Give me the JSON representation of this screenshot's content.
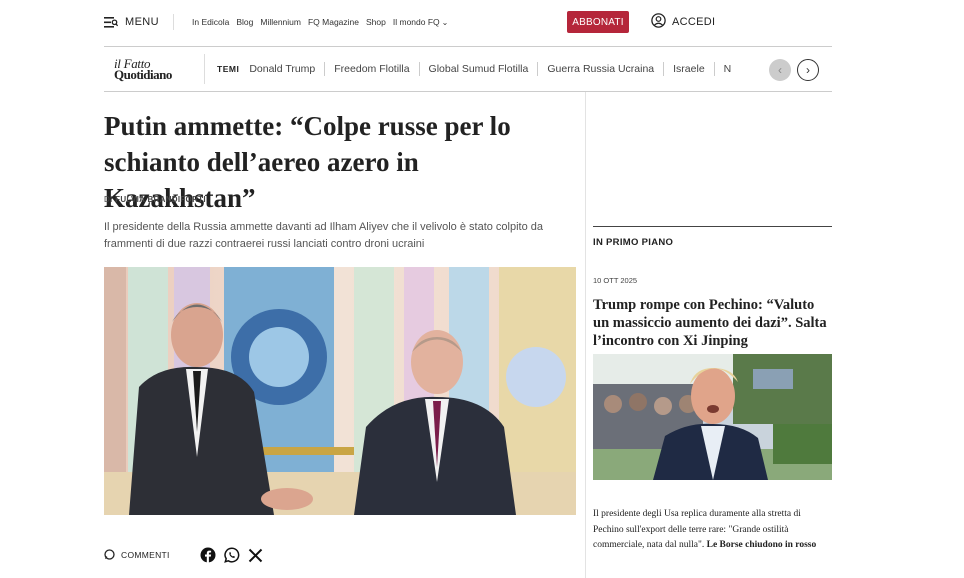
{
  "header": {
    "menu_label": "MENU",
    "links": [
      "In Edicola",
      "Blog",
      "Millennium",
      "FQ Magazine",
      "Shop",
      "Il mondo FQ"
    ],
    "subscribe_label": "ABBONATI",
    "login_label": "ACCEDI",
    "accent_color": "#b5263a"
  },
  "logo": {
    "line1": "il Fatto",
    "line2": "Quotidiano"
  },
  "temi": {
    "label": "TEMI",
    "items": [
      "Donald Trump",
      "Freedom Flotilla",
      "Global Sumud Flotilla",
      "Guerra Russia Ucraina",
      "Israele",
      "N"
    ]
  },
  "article": {
    "title": "Putin ammette: “Colpe russe per lo schianto dell’aereo azero in Kazakhstan”",
    "byline_prefix": "DI",
    "author": "FULVIA BRANDIFORTI",
    "summary": "Il presidente della Russia ammette davanti ad Ilham Aliyev che il velivolo è stato colpito da frammenti di due razzi contraerei russi lanciati contro droni ucraini",
    "comments_label": "COMMENTI",
    "share_icons": [
      "facebook-icon",
      "whatsapp-icon",
      "x-icon"
    ]
  },
  "sidebar": {
    "section_label": "IN PRIMO PIANO",
    "date": "10 OTT 2025",
    "title": "Trump rompe con Pechino: “Valuto un massiccio aumento dei dazi”. Salta l’incontro con Xi Jinping",
    "desc_text": "Il presidente degli Usa replica duramente alla stretta di Pechino sull'export delle terre rare: \"Grande ostilità commerciale, nata dal nulla\".",
    "desc_bold": "Le Borse chiudono in rosso"
  }
}
